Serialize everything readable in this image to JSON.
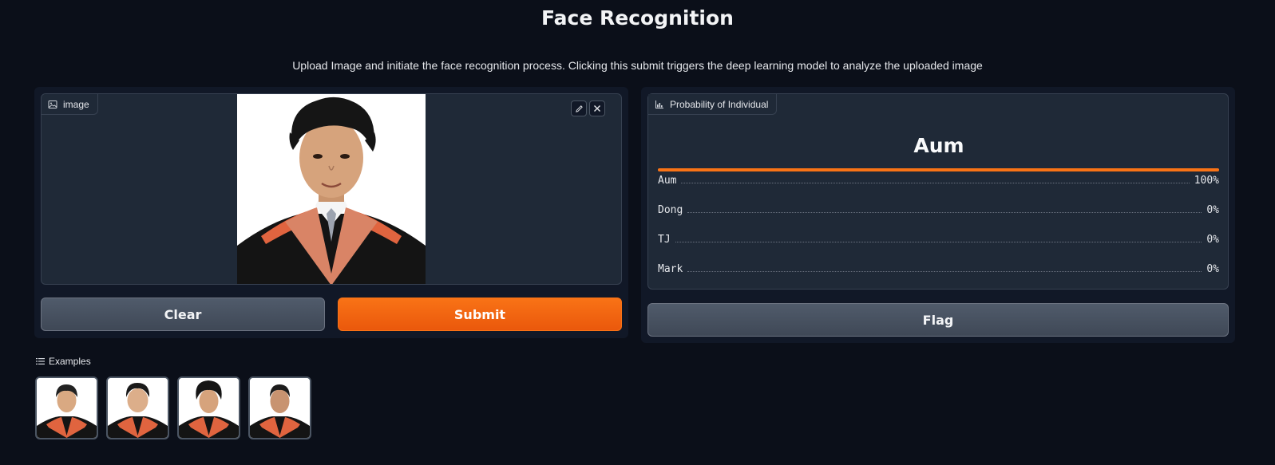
{
  "header": {
    "title": "Face Recognition",
    "subtitle": "Upload Image and initiate the face recognition process. Clicking this submit triggers the deep learning model to analyze the uploaded image"
  },
  "input": {
    "label": "image",
    "edit_icon": "pencil-icon",
    "clear_icon": "close-icon"
  },
  "buttons": {
    "clear": "Clear",
    "submit": "Submit",
    "flag": "Flag"
  },
  "output": {
    "label": "Probability of Individual",
    "top_class": "Aum",
    "confidences": [
      {
        "name": "Aum",
        "value": "100%",
        "fraction": 1.0
      },
      {
        "name": "Dong",
        "value": "0%",
        "fraction": 0.0
      },
      {
        "name": "TJ",
        "value": "0%",
        "fraction": 0.0
      },
      {
        "name": "Mark",
        "value": "0%",
        "fraction": 0.0
      }
    ]
  },
  "examples": {
    "label": "Examples",
    "count": 4
  },
  "colors": {
    "accent": "#f97316",
    "background": "#0b0f19",
    "panel": "#111827",
    "box": "#1f2937"
  }
}
